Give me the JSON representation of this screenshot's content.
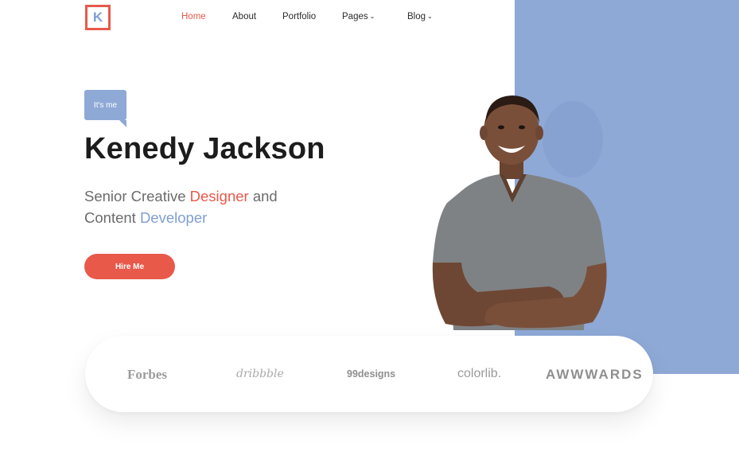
{
  "logo": {
    "letter": "K"
  },
  "nav": {
    "items": [
      {
        "label": "Home",
        "active": true
      },
      {
        "label": "About"
      },
      {
        "label": "Portfolio"
      },
      {
        "label": "Pages",
        "dropdown": true
      },
      {
        "label": "Blog",
        "dropdown": true
      }
    ],
    "chevron": "⌄"
  },
  "hero": {
    "tag": "It's me",
    "name": "Kenedy Jackson",
    "subtitle": {
      "part1": "Senior Creative ",
      "highlight1": "Designer",
      "part2": " and",
      "part3": "Content ",
      "highlight2": "Developer"
    },
    "cta": "Hire Me"
  },
  "brands": [
    "Forbes",
    "dribbble",
    "99designs",
    "colorlib.",
    "AWWWARDS"
  ],
  "colors": {
    "accent": "#e8594a",
    "blue": "#8ea9d6",
    "text_blue": "#7f9fd2"
  }
}
